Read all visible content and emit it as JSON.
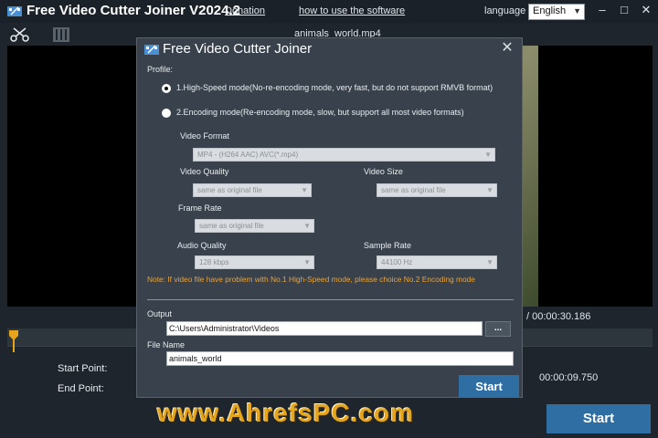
{
  "app": {
    "title": "Free Video Cutter Joiner V2024.2",
    "donation_link": "Donation",
    "howto_link": "how to use the software",
    "language_label": "language",
    "language_value": "English"
  },
  "window_controls": {
    "minimize": "–",
    "maximize": "□",
    "close": "✕"
  },
  "toolbar": {
    "cut_icon": "scissors-icon",
    "join_icon": "film-strip-icon"
  },
  "player": {
    "filename": "animals_world.mp4",
    "total_time": "/ 00:00:30.186",
    "start_point_label": "Start Point:",
    "end_point_label": "End Point:",
    "end_time": "00:00:09.750",
    "start_button": "Start"
  },
  "watermark": "www.AhrefsPC.com",
  "dialog": {
    "title": "Free Video Cutter Joiner",
    "close_symbol": "✕",
    "profile_label": "Profile:",
    "mode1": "1.High-Speed mode(No-re-encoding mode, very fast, but do not support RMVB format)",
    "mode2": "2.Encoding mode(Re-encoding mode, slow, but support all most video formats)",
    "selected_mode": 1,
    "video_format_label": "Video Format",
    "video_format_value": "MP4 - (H264 AAC) AVC(*.mp4)",
    "video_quality_label": "Video Quality",
    "video_quality_value": "same as original file",
    "video_size_label": "Video Size",
    "video_size_value": "same as original file",
    "frame_rate_label": "Frame Rate",
    "frame_rate_value": "same as original file",
    "audio_quality_label": "Audio Quality",
    "audio_quality_value": "128 kbps",
    "sample_rate_label": "Sample Rate",
    "sample_rate_value": "44100 Hz",
    "note": "Note: If video file have problem with No.1 High-Speed mode, please choice No.2 Encoding mode",
    "output_label": "Output",
    "output_value": "C:\\Users\\Administrator\\Videos",
    "browse_label": "...",
    "filename_label": "File Name",
    "filename_value": "animals_world",
    "start_button": "Start"
  },
  "colors": {
    "background": "#1e252c",
    "dialog": "#39424c",
    "accent": "#2e6ea2",
    "note": "#e7a23a",
    "watermark": "#e5a51c"
  }
}
